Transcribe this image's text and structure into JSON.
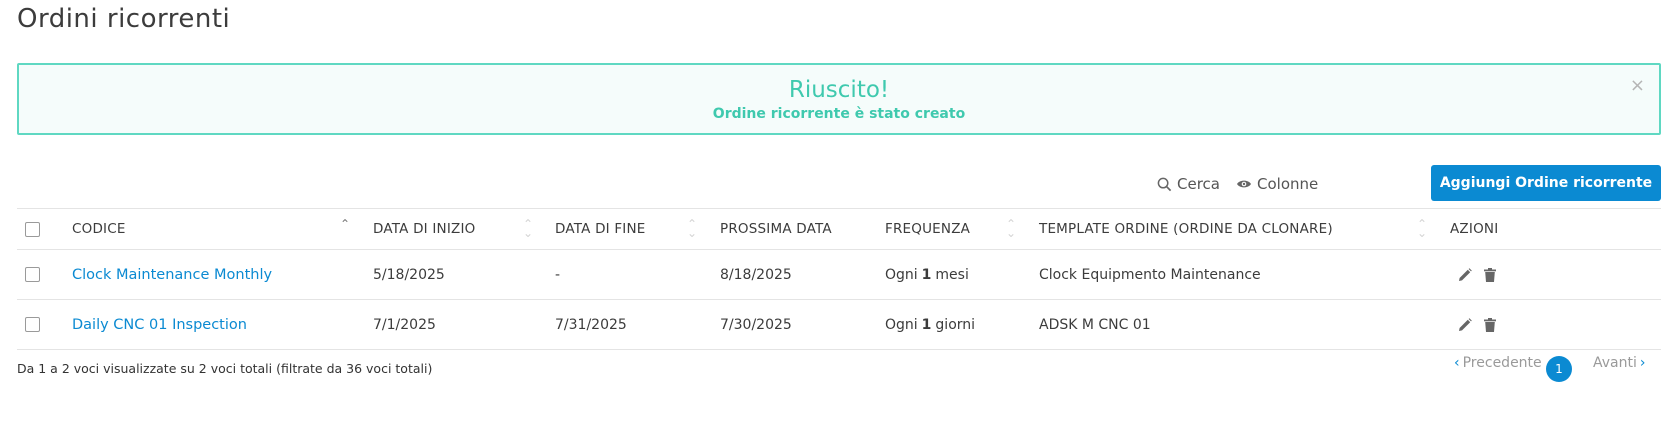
{
  "page": {
    "title": "Ordini ricorrenti"
  },
  "alert": {
    "title": "Riuscito!",
    "message": "Ordine ricorrente è stato creato",
    "close": "×"
  },
  "toolbar": {
    "search_label": "Cerca",
    "columns_label": "Colonne",
    "add_label": "Aggiungi Ordine ricorrente"
  },
  "table": {
    "headers": {
      "code": "CODICE",
      "start": "DATA DI INIZIO",
      "end": "DATA DI FINE",
      "next": "PROSSIMA DATA",
      "frequency": "FREQUENZA",
      "template": "TEMPLATE ORDINE (ORDINE DA CLONARE)",
      "actions": "AZIONI"
    },
    "rows": [
      {
        "code": "Clock Maintenance Monthly",
        "start": "5/18/2025",
        "end": "-",
        "next": "8/18/2025",
        "freq_prefix": "Ogni",
        "freq_value": "1",
        "freq_unit": "mesi",
        "template": "Clock Equipmento Maintenance"
      },
      {
        "code": "Daily CNC 01 Inspection",
        "start": "7/1/2025",
        "end": "7/31/2025",
        "next": "7/30/2025",
        "freq_prefix": "Ogni",
        "freq_value": "1",
        "freq_unit": "giorni",
        "template": "ADSK M CNC 01"
      }
    ]
  },
  "footer": {
    "info": "Da 1 a 2 voci visualizzate su 2 voci totali (filtrate da 36 voci totali)",
    "prev_label": "Precedente",
    "page": "1",
    "next_label": "Avanti"
  },
  "colors": {
    "accent": "#0b8ad2",
    "success": "#3fc9ae",
    "success_border": "#5fd8c2"
  }
}
